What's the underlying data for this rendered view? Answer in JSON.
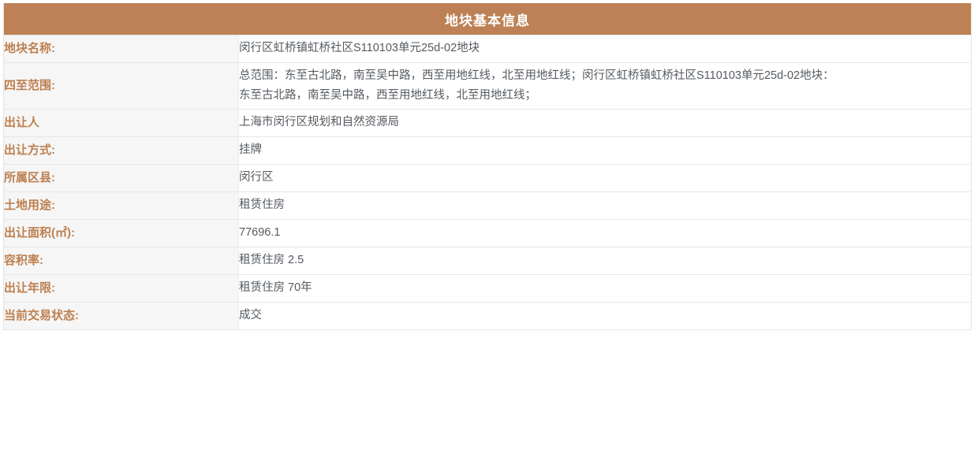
{
  "table": {
    "title": "地块基本信息",
    "accent_color": "#bd8155",
    "label_color": "#bd7f4f",
    "value_color": "#555a5f",
    "label_bg": "#f6f6f6",
    "value_bg": "#ffffff",
    "border_color": "#e6e6e6",
    "rows": [
      {
        "label": "地块名称:",
        "lines": [
          "闵行区虹桥镇虹桥社区S110103单元25d-02地块"
        ]
      },
      {
        "label": "四至范围:",
        "lines": [
          "总范围：东至古北路，南至吴中路，西至用地红线，北至用地红线；闵行区虹桥镇虹桥社区S110103单元25d-02地块：",
          "东至古北路，南至吴中路，西至用地红线，北至用地红线；"
        ]
      },
      {
        "label": "出让人",
        "lines": [
          "上海市闵行区规划和自然资源局"
        ]
      },
      {
        "label": "出让方式:",
        "lines": [
          "挂牌"
        ]
      },
      {
        "label": "所属区县:",
        "lines": [
          "闵行区"
        ]
      },
      {
        "label": "土地用途:",
        "lines": [
          "租赁住房"
        ]
      },
      {
        "label": "出让面积(㎡):",
        "lines": [
          "77696.1"
        ]
      },
      {
        "label": "容积率:",
        "lines": [
          "租赁住房 2.5"
        ]
      },
      {
        "label": "出让年限:",
        "lines": [
          "租赁住房 70年"
        ]
      },
      {
        "label": "当前交易状态:",
        "lines": [
          "成交"
        ]
      }
    ]
  }
}
